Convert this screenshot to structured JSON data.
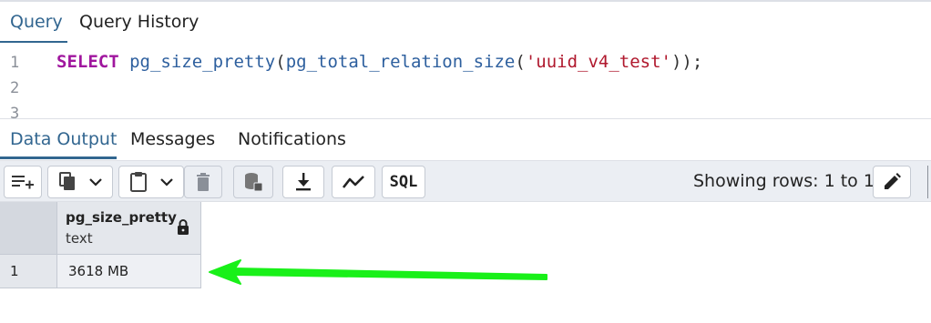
{
  "query_tabs": [
    {
      "label": "Query",
      "active": true
    },
    {
      "label": "Query History",
      "active": false
    }
  ],
  "editor": {
    "line_numbers": [
      "1",
      "2",
      "3"
    ],
    "code": {
      "keyword": "SELECT",
      "fn1": "pg_size_pretty",
      "open1": "(",
      "fn2": "pg_total_relation_size",
      "open2": "(",
      "string": "'uuid_v4_test'",
      "close": "));"
    }
  },
  "result_tabs": [
    {
      "label": "Data Output",
      "active": true
    },
    {
      "label": "Messages",
      "active": false
    },
    {
      "label": "Notifications",
      "active": false
    }
  ],
  "toolbar": {
    "buttons": [
      "add-row-icon",
      "copy-icon",
      "chevron-down-icon",
      "paste-icon",
      "chevron-down-icon",
      "delete-icon",
      "save-data-icon",
      "download-icon",
      "graph-icon",
      "sql-icon"
    ],
    "sql_label": "SQL",
    "rows_text": "Showing rows: 1 to 1",
    "edit_icon": "pencil-icon"
  },
  "grid": {
    "columns": [
      {
        "name": "pg_size_pretty",
        "type": "text",
        "icon": "lock-icon"
      }
    ],
    "rows": [
      {
        "num": "1",
        "cells": [
          "3618 MB"
        ]
      }
    ]
  },
  "annotation": {
    "icon": "arrow-left-icon",
    "color": "#19f019"
  },
  "colors": {
    "accent": "#326690",
    "toolbar_bg": "#ebeef3",
    "header_bg": "#e4e7ec",
    "keyword": "#a0169e",
    "string": "#b0182d"
  }
}
